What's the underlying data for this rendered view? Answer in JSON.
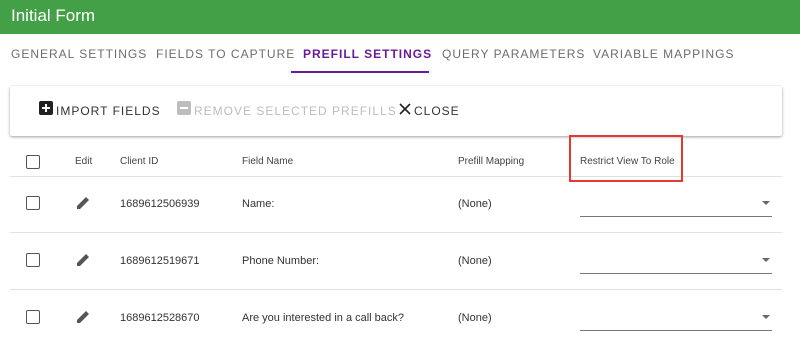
{
  "window": {
    "title": "Initial Form"
  },
  "tabs": [
    {
      "label": "GENERAL SETTINGS",
      "active": false
    },
    {
      "label": "FIELDS TO CAPTURE",
      "active": false
    },
    {
      "label": "PREFILL SETTINGS",
      "active": true
    },
    {
      "label": "QUERY PARAMETERS",
      "active": false
    },
    {
      "label": "VARIABLE MAPPINGS",
      "active": false
    }
  ],
  "toolbar": {
    "import_label": "IMPORT FIELDS",
    "remove_label": "REMOVE SELECTED PREFILLS",
    "close_label": "CLOSE"
  },
  "table": {
    "columns": {
      "edit": "Edit",
      "client_id": "Client ID",
      "field_name": "Field Name",
      "prefill_mapping": "Prefill Mapping",
      "restrict_view": "Restrict View To Role"
    },
    "rows": [
      {
        "client_id": "1689612506939",
        "field_name": "Name:",
        "prefill_mapping": "(None)",
        "role": ""
      },
      {
        "client_id": "1689612519671",
        "field_name": "Phone Number:",
        "prefill_mapping": "(None)",
        "role": ""
      },
      {
        "client_id": "1689612528670",
        "field_name": "Are you interested in a call back?",
        "prefill_mapping": "(None)",
        "role": ""
      }
    ]
  },
  "colors": {
    "header_green": "#43a047",
    "active_tab": "#6a1b9a",
    "highlight_box": "#e53935"
  },
  "icons": [
    "plus-box-icon",
    "minus-box-icon",
    "close-icon",
    "pencil-icon",
    "dropdown-caret-icon"
  ]
}
